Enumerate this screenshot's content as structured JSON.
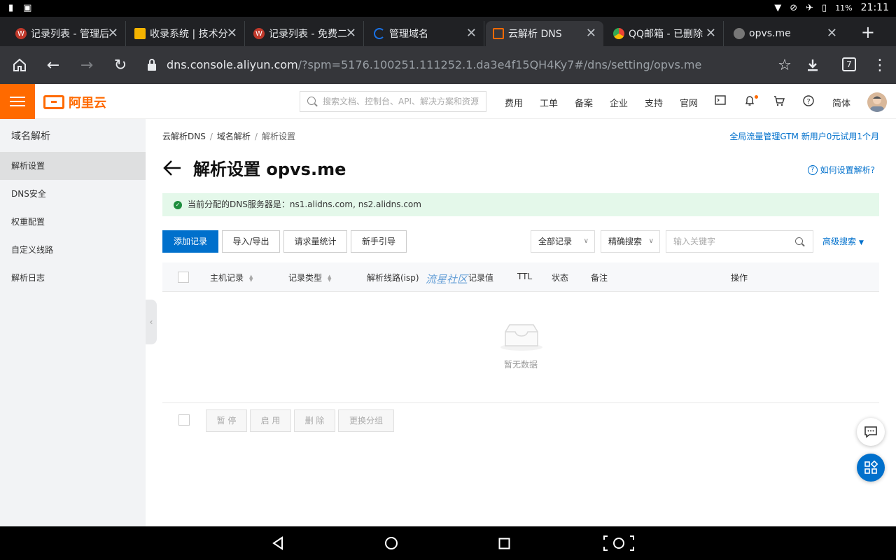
{
  "status_bar": {
    "battery": "11%",
    "time": "21:11"
  },
  "tabs": [
    {
      "title": "记录列表 - 管理后",
      "favicon_color": "#c0392b"
    },
    {
      "title": "收录系统 | 技术分",
      "favicon_color": "#f5b400"
    },
    {
      "title": "记录列表 - 免费二",
      "favicon_color": "#c0392b"
    },
    {
      "title": "管理域名",
      "favicon_color": "#1a73e8"
    },
    {
      "title": "云解析 DNS",
      "favicon_color": "#ff6a00"
    },
    {
      "title": "QQ邮箱 - 已删除",
      "favicon_color": "#34a853"
    },
    {
      "title": "opvs.me",
      "favicon_color": "#777777"
    }
  ],
  "address": {
    "host": "dns.console.aliyun.com",
    "path": "/?spm=5176.100251.111252.1.da3e4f15QH4Ky7#/dns/setting/opvs.me",
    "tab_count": "7"
  },
  "header": {
    "logo_text": "阿里云",
    "search_placeholder": "搜索文档、控制台、API、解决方案和资源",
    "nav": [
      "费用",
      "工单",
      "备案",
      "企业",
      "支持",
      "官网"
    ],
    "language": "简体"
  },
  "sidebar": {
    "title": "域名解析",
    "items": [
      {
        "label": "解析设置",
        "active": true
      },
      {
        "label": "DNS安全",
        "active": false
      },
      {
        "label": "权重配置",
        "active": false
      },
      {
        "label": "自定义线路",
        "active": false
      },
      {
        "label": "解析日志",
        "active": false
      }
    ]
  },
  "breadcrumb": [
    "云解析DNS",
    "域名解析",
    "解析设置"
  ],
  "promo_link": "全局流量管理GTM 新用户0元试用1个月",
  "page_title": "解析设置 opvs.me",
  "help_link": "如何设置解析?",
  "notice": "当前分配的DNS服务器是：ns1.alidns.com, ns2.alidns.com",
  "toolbar": {
    "add": "添加记录",
    "import_export": "导入/导出",
    "stats": "请求量统计",
    "guide": "新手引导",
    "filter_all": "全部记录",
    "filter_exact": "精确搜索",
    "keyword_placeholder": "输入关键字",
    "advanced": "高级搜索"
  },
  "table": {
    "columns": [
      "主机记录",
      "记录类型",
      "解析线路(isp)",
      "记录值",
      "TTL",
      "状态",
      "备注",
      "操作"
    ],
    "empty_text": "暂无数据"
  },
  "watermark": "流星社区",
  "bulk_actions": [
    "暂 停",
    "启 用",
    "删 除",
    "更换分组"
  ],
  "colors": {
    "brand": "#ff6a00",
    "primary": "#0070cc",
    "success_bg": "#e4f8ea"
  }
}
